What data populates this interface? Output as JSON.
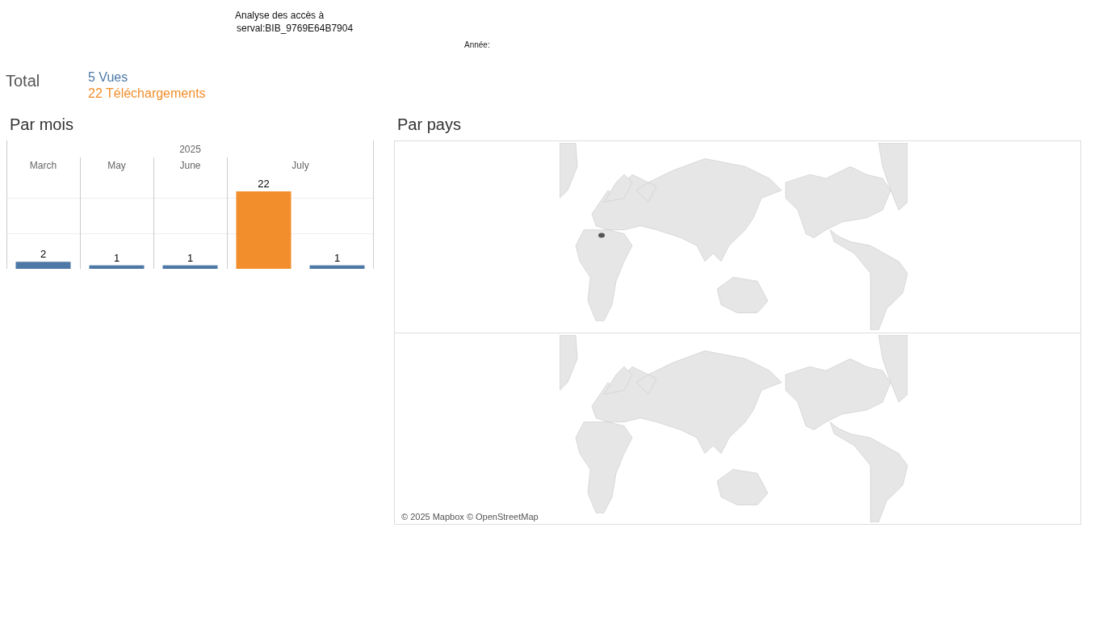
{
  "header": {
    "title_line_1": "Analyse des accès à",
    "title_line_2": "serval:BIB_9769E64B7904",
    "year_filter_label": "Année:"
  },
  "totals": {
    "label": "Total",
    "items": [
      {
        "text": "5 Vues",
        "color": "#4e79a7"
      },
      {
        "text": "22 Téléchargements",
        "color": "#f28e2b"
      }
    ]
  },
  "by_month": {
    "title": "Par mois",
    "year_header": "2025",
    "chart_data": {
      "type": "bar",
      "categories": [
        "March",
        "May",
        "June",
        "July"
      ],
      "series": [
        {
          "color": "#f28e2b",
          "values": [
            null,
            null,
            null,
            22
          ]
        },
        {
          "color": "#4e79a7",
          "values": [
            2,
            1,
            1,
            1
          ]
        }
      ],
      "data_labels": true
    }
  },
  "by_country": {
    "title": "Par pays",
    "attribution": "© 2025 Mapbox © OpenStreetMap"
  }
}
